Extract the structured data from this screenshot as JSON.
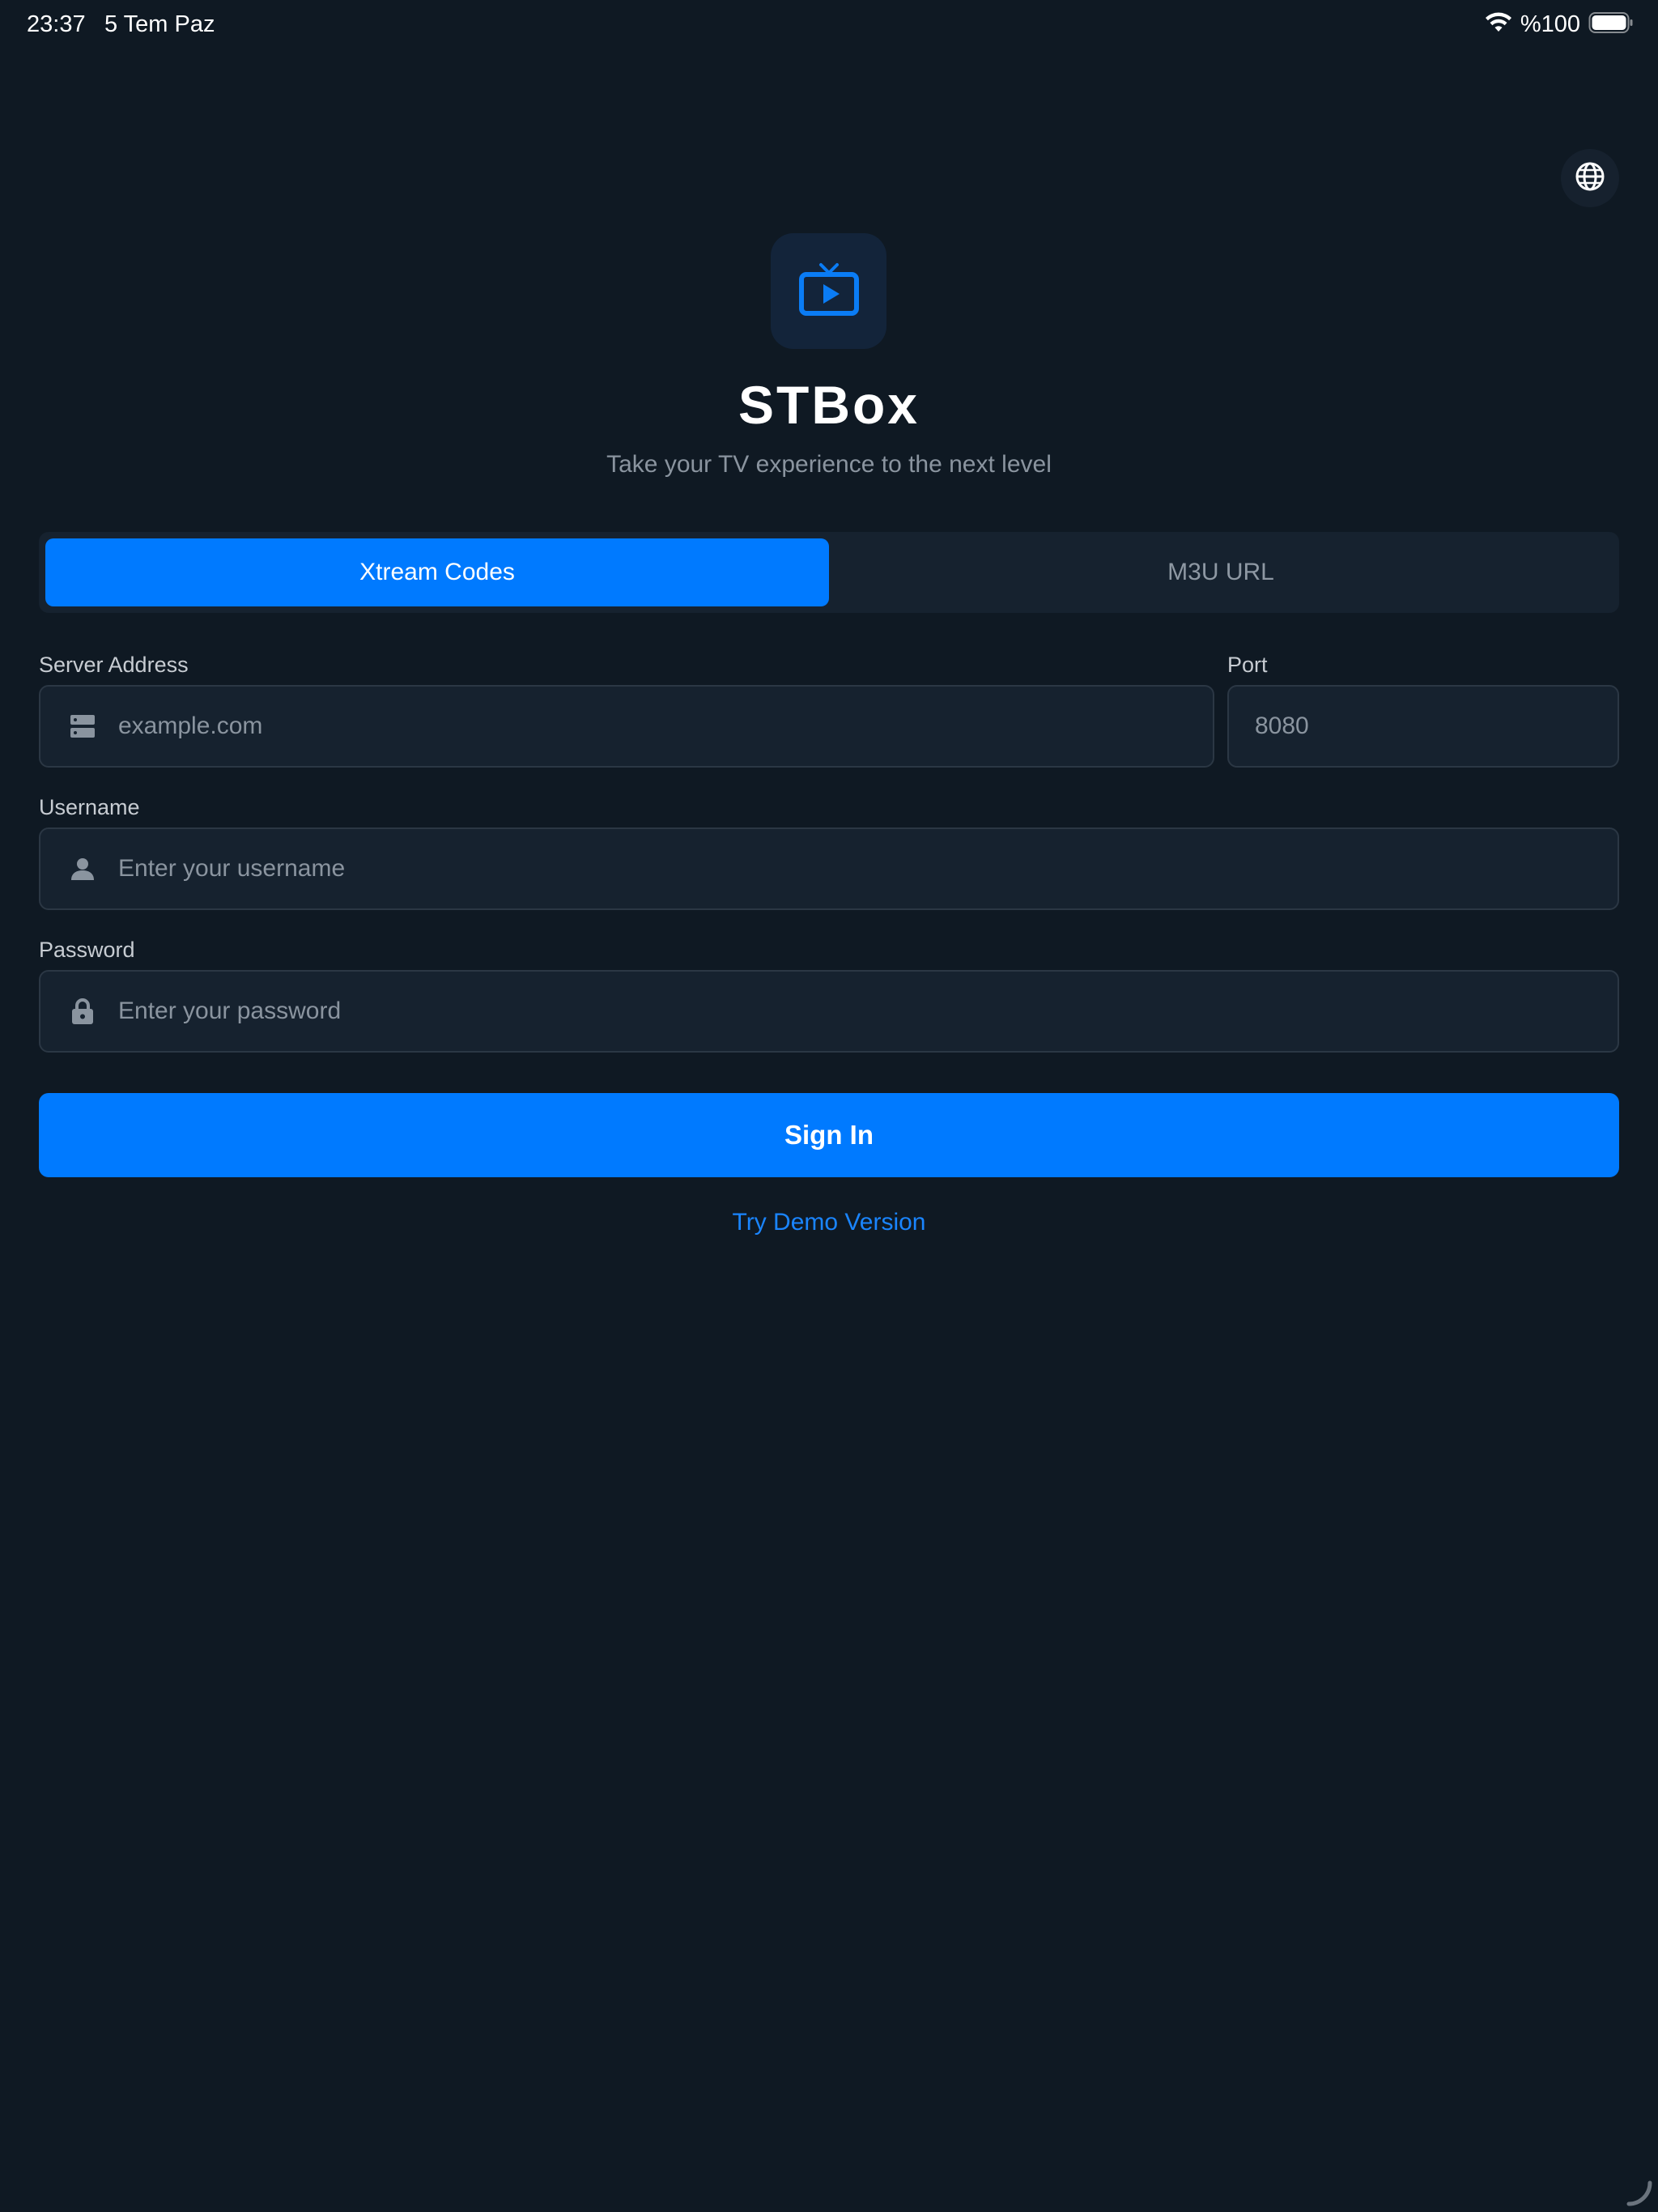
{
  "status_bar": {
    "time": "23:37",
    "date": "5 Tem Paz",
    "battery": "%100"
  },
  "app": {
    "title": "STBox",
    "subtitle": "Take your TV experience to the next level"
  },
  "tabs": [
    {
      "label": "Xtream Codes",
      "active": true
    },
    {
      "label": "M3U URL",
      "active": false
    }
  ],
  "form": {
    "server": {
      "label": "Server Address",
      "placeholder": "example.com",
      "value": ""
    },
    "port": {
      "label": "Port",
      "placeholder": "8080",
      "value": ""
    },
    "username": {
      "label": "Username",
      "placeholder": "Enter your username",
      "value": ""
    },
    "password": {
      "label": "Password",
      "placeholder": "Enter your password",
      "value": ""
    }
  },
  "actions": {
    "sign_in": "Sign In",
    "demo": "Try Demo Version"
  },
  "icons": {
    "globe": "globe-icon",
    "logo": "tv-play-icon",
    "server": "server-icon",
    "user": "person-icon",
    "lock": "lock-icon",
    "wifi": "wifi-icon",
    "battery": "battery-icon"
  },
  "colors": {
    "background": "#0f1923",
    "accent": "#007aff",
    "surface": "#16222f",
    "muted_text": "#8a949f"
  }
}
